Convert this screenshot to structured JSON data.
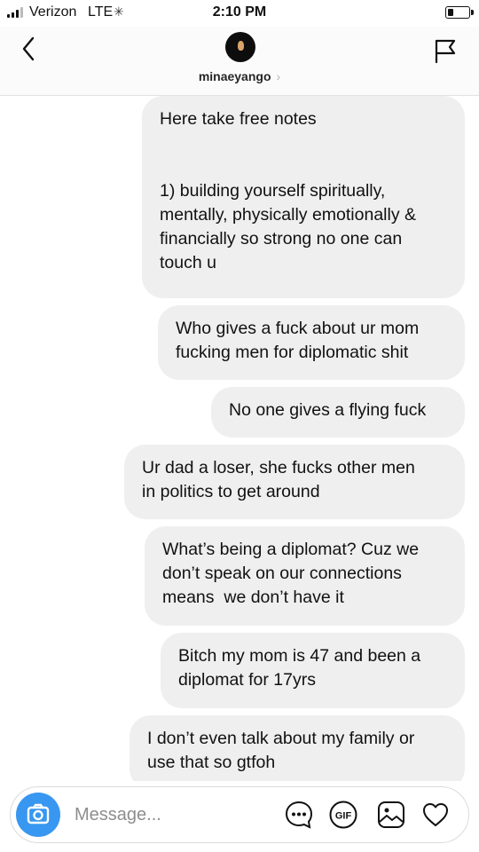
{
  "status_bar": {
    "carrier": "Verizon",
    "network": "LTE",
    "time": "2:10 PM",
    "battery_level": 0.3
  },
  "header": {
    "username": "minaeyango",
    "chevron": "›",
    "back_icon": "chevron-left-icon",
    "flag_icon": "flag-icon"
  },
  "messages": [
    {
      "text": "Here take free notes\n\n\n1) building yourself spiritually,\nmentally, physically emotionally &\nfinancially so strong no one can\ntouch u",
      "sender": "self"
    },
    {
      "text": "Who gives a fuck about ur mom\nfucking men for diplomatic shit",
      "sender": "self"
    },
    {
      "text": "No one gives a flying fuck",
      "sender": "self"
    },
    {
      "text": "Ur dad a loser, she fucks other men\nin politics to get around",
      "sender": "self"
    },
    {
      "text": "What’s being a diplomat? Cuz we\ndon’t speak on our connections\nmeans  we don’t have it",
      "sender": "self"
    },
    {
      "text": "Bitch my mom is 47 and been a\ndiplomat for 17yrs",
      "sender": "self"
    },
    {
      "text": "I don’t even talk about my family or\nuse that so gtfoh",
      "sender": "self"
    }
  ],
  "composer": {
    "placeholder": "Message...",
    "gif_label": "GIF",
    "icons": [
      "camera-icon",
      "ellipsis-icon",
      "gif-icon",
      "image-icon",
      "heart-icon"
    ]
  },
  "colors": {
    "bubble": "#efefef",
    "camera_button": "#3897f0",
    "header_bg": "#fbfbfb"
  }
}
